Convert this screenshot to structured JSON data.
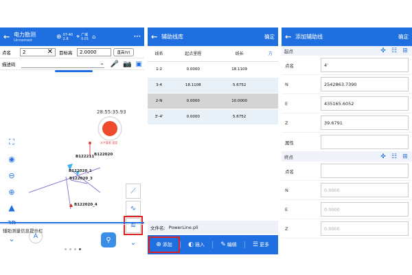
{
  "left": {
    "title": "电力勘测",
    "subtitle": "Unnamed",
    "status_icons": {
      "sat": "07-40",
      "sat_sub": "2.8",
      "mode": "广域",
      "mode_sub": "0.01"
    },
    "more_label": "···",
    "point_label": "点名",
    "point_value": "2",
    "target_label": "目标高",
    "target_value": "2.0000",
    "target_unit": "直高(V)",
    "code_label": "描述码",
    "timer": "28:55:35.93",
    "precision_label": "水平要差 固定",
    "points": [
      "B122211",
      "B122020",
      "B122020_1",
      "B122020_3",
      "B122020_4"
    ],
    "left_btns": [
      "fit-icon",
      "layers-icon",
      "zoom-out-icon",
      "zoom-in-icon",
      "north-icon",
      "3d-icon",
      "collapse-icon"
    ],
    "btn_3d": "3D",
    "right_btns": [
      "line-tool-icon",
      "curve-tool-icon",
      "aux-survey-icon",
      "expand-icon"
    ],
    "message": "辅助测量信息提示栏"
  },
  "middle": {
    "title": "辅助线库",
    "confirm": "确定",
    "headers": [
      "线名",
      "起点里程",
      "线长",
      "方"
    ],
    "rows": [
      [
        "1-2",
        "0.0000",
        "18.1109"
      ],
      [
        "3-4",
        "18.1108",
        "5.6752"
      ],
      [
        "2-N",
        "0.0000",
        "10.0000"
      ],
      [
        "3'-4'",
        "0.0000",
        "5.6752"
      ]
    ],
    "file_label": "文件名:",
    "file_name": "PowerLine.pli",
    "actions": [
      "添加",
      "插入",
      "编辑",
      "更多"
    ]
  },
  "right": {
    "title": "添加辅助线",
    "confirm": "确定",
    "start_label": "起点",
    "end_label": "终点",
    "start_fields": [
      {
        "label": "点名",
        "value": "4'"
      },
      {
        "label": "N",
        "value": "2542863.7390"
      },
      {
        "label": "E",
        "value": "435165.6052"
      },
      {
        "label": "Z",
        "value": "39.6791"
      },
      {
        "label": "属性",
        "value": ""
      }
    ],
    "end_fields": [
      {
        "label": "点名",
        "value": ""
      },
      {
        "label": "N",
        "value": "0.0000"
      },
      {
        "label": "E",
        "value": "0.0000"
      },
      {
        "label": "Z",
        "value": "0.0000"
      }
    ]
  },
  "colors": {
    "primary": "#1f6fe0",
    "highlight": "#e02020"
  }
}
